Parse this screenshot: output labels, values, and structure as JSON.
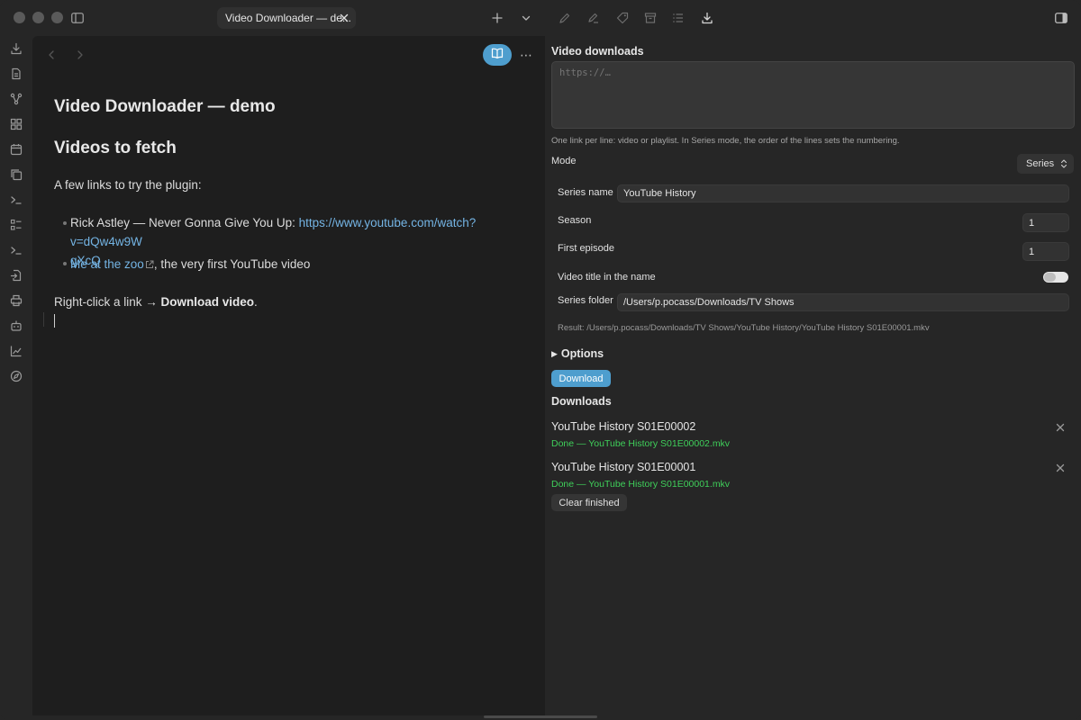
{
  "tab": {
    "title": "Video Downloader — de..."
  },
  "icons": {
    "titlebar_left": [
      "sidebar-toggle-icon"
    ],
    "titlebar_center": [
      "plus-icon",
      "chevron-down-icon"
    ],
    "titlebar_right": [
      "pen-icon",
      "signature-icon",
      "tag-icon",
      "archive-icon",
      "list-icon",
      "download-icon"
    ],
    "titlebar_far_right": [
      "right-sidebar-toggle-icon"
    ],
    "ribbon": [
      "download-icon",
      "file-icon",
      "graph-icon",
      "grid-icon",
      "calendar-icon",
      "copy-icon",
      "terminal-icon",
      "checklist-icon",
      "terminal-icon",
      "file-import-icon",
      "print-icon",
      "robot-icon",
      "chart-icon",
      "compass-icon"
    ]
  },
  "editor": {
    "h1": "Video Downloader — demo",
    "h2": "Videos to fetch",
    "intro": "A few links to try the plugin:",
    "list": [
      {
        "prefix": "Rick Astley — Never Gonna Give You Up: ",
        "link_line1": "https://www.youtube.com/watch?v=dQw4w9W",
        "link_line2": "gXcQ"
      },
      {
        "link": "Me at the zoo",
        "suffix": ", the very first YouTube video"
      }
    ],
    "outro_prefix": "Right-click a link → ",
    "outro_bold": "Download video",
    "outro_suffix": "."
  },
  "panel": {
    "heading": "Video downloads",
    "url_placeholder": "https://…",
    "url_value": "",
    "hint": "One link per line: video or playlist. In Series mode, the order of the lines sets the numbering.",
    "mode_label": "Mode",
    "mode_value": "Series",
    "series_name_label": "Series name",
    "series_name_value": "YouTube History",
    "season_label": "Season",
    "season_value": "1",
    "first_episode_label": "First episode",
    "first_episode_value": "1",
    "title_in_name_label": "Video title in the name",
    "title_in_name_on": true,
    "series_folder_label": "Series folder",
    "series_folder_value": "/Users/p.pocass/Downloads/TV Shows",
    "result": "Result: /Users/p.pocass/Downloads/TV Shows/YouTube History/YouTube History S01E00001.mkv",
    "options_label": "Options",
    "download_label": "Download",
    "downloads_heading": "Downloads",
    "downloads": [
      {
        "title": "YouTube History S01E00002",
        "status": "Done — YouTube History S01E00002.mkv"
      },
      {
        "title": "YouTube History S01E00001",
        "status": "Done — YouTube History S01E00001.mkv"
      }
    ],
    "clear_label": "Clear finished"
  },
  "colors": {
    "accent": "#4e9ece",
    "link": "#74b4e4",
    "success": "#3fcf5a",
    "editor_bg": "#1e1e1e",
    "panel_bg": "#262626"
  }
}
